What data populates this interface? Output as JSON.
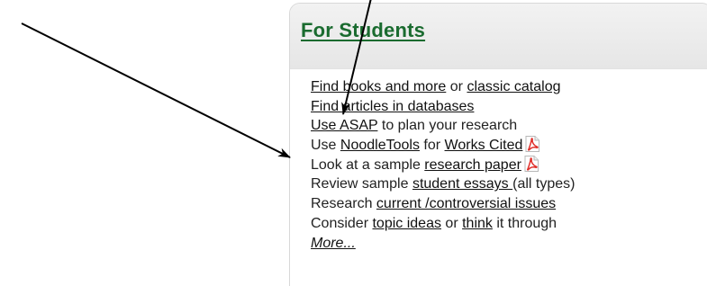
{
  "panel": {
    "title": "For Students",
    "lines": [
      {
        "link1": "Find books and more",
        "text1": " or ",
        "link2": "classic catalog"
      },
      {
        "link1": "Find articles in databases"
      },
      {
        "link1": "Use ASAP",
        "text1": " to plan your research"
      },
      {
        "text0": "Use ",
        "link1": "NoodleTools",
        "text1": " for ",
        "link2": "Works Cited",
        "pdf": true
      },
      {
        "text0": "Look at a sample ",
        "link1": "research paper",
        "pdf": true
      },
      {
        "text0": "Review sample ",
        "link1": "student essays ",
        "text1": "(all types)"
      },
      {
        "text0": "Research ",
        "link1": "current /controversial issues"
      },
      {
        "text0": "Consider ",
        "link1": "topic ideas",
        "text1": " or ",
        "link2": "think",
        "text2": " it through"
      },
      {
        "link1": "More..."
      }
    ]
  },
  "icons": {
    "pdf": "pdf-icon"
  },
  "colors": {
    "title": "#1a6b2f",
    "header_bg": "#eeeeee",
    "pdf_red": "#e0302b",
    "arrow": "#000000"
  }
}
